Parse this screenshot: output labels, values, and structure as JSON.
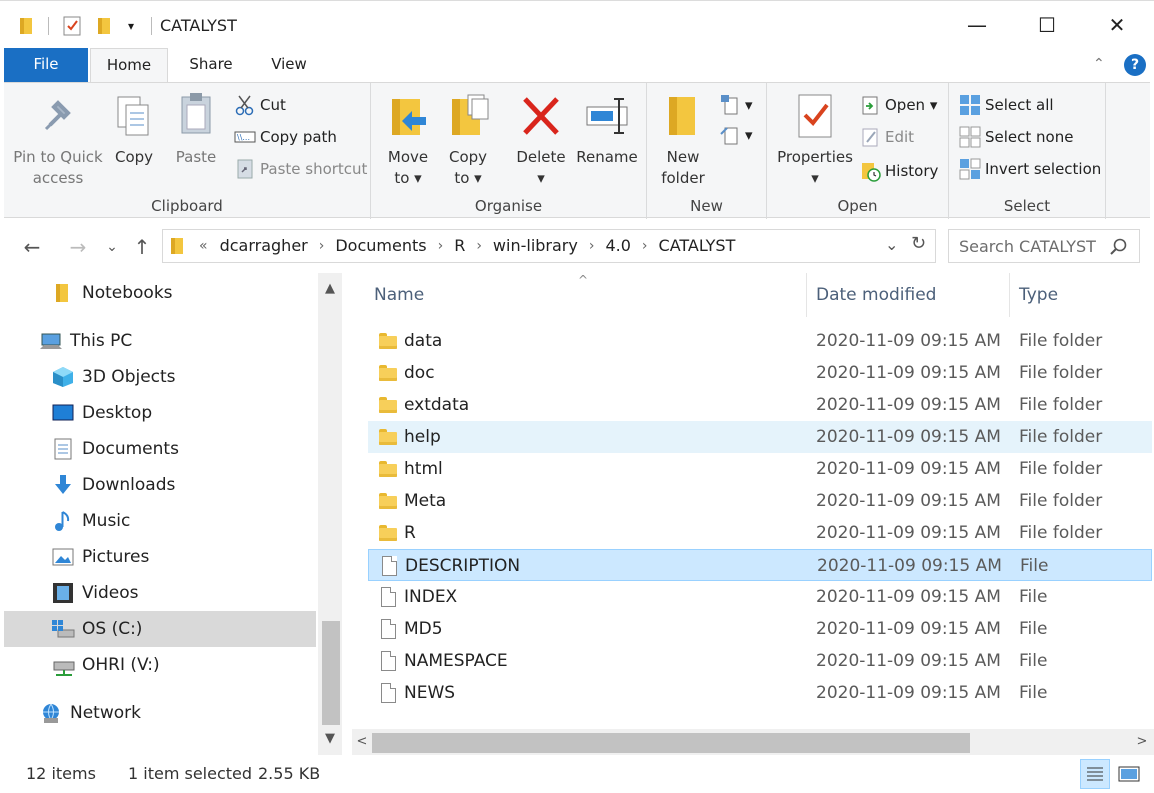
{
  "window": {
    "title": "CATALYST",
    "minimize": "—",
    "maximize": "☐",
    "close": "✕",
    "qa_dropdown": "▾"
  },
  "tabs": {
    "file": "File",
    "home": "Home",
    "share": "Share",
    "view": "View",
    "collapse": "⌃",
    "help": "?"
  },
  "ribbon": {
    "clipboard": {
      "label": "Clipboard",
      "pin_line1": "Pin to Quick",
      "pin_line2": "access",
      "copy": "Copy",
      "paste": "Paste",
      "cut": "Cut",
      "copy_path": "Copy path",
      "paste_shortcut": "Paste shortcut"
    },
    "organise": {
      "label": "Organise",
      "move_line1": "Move",
      "move_line2": "to",
      "copy_line1": "Copy",
      "copy_line2": "to",
      "delete": "Delete",
      "rename": "Rename",
      "dropdown": "▾"
    },
    "new": {
      "label": "New",
      "new_folder_line1": "New",
      "new_folder_line2": "folder"
    },
    "open": {
      "label": "Open",
      "properties": "Properties",
      "open": "Open",
      "edit": "Edit",
      "history": "History"
    },
    "select": {
      "label": "Select",
      "select_all": "Select all",
      "select_none": "Select none",
      "invert_selection": "Invert selection"
    }
  },
  "nav": {
    "back": "←",
    "forward": "→",
    "recent": "⌄",
    "up": "↑",
    "overflow": "«",
    "crumbs": [
      "dcarragher",
      "Documents",
      "R",
      "win-library",
      "4.0",
      "CATALYST"
    ],
    "chevron": "›",
    "dropdown": "⌄",
    "refresh": "↻",
    "search_placeholder": "Search CATALYST"
  },
  "navpane": {
    "items": [
      "Notebooks",
      "This PC",
      "3D Objects",
      "Desktop",
      "Documents",
      "Downloads",
      "Music",
      "Pictures",
      "Videos",
      "OS (C:)",
      "OHRI (V:)",
      "Network"
    ],
    "scroll_up": "▲",
    "scroll_down": "▼"
  },
  "filelist": {
    "columns": {
      "name": "Name",
      "date": "Date modified",
      "type": "Type"
    },
    "sort_indicator": "^",
    "rows": [
      {
        "name": "data",
        "date": "2020-11-09 09:15 AM",
        "type": "File folder"
      },
      {
        "name": "doc",
        "date": "2020-11-09 09:15 AM",
        "type": "File folder"
      },
      {
        "name": "extdata",
        "date": "2020-11-09 09:15 AM",
        "type": "File folder"
      },
      {
        "name": "help",
        "date": "2020-11-09 09:15 AM",
        "type": "File folder"
      },
      {
        "name": "html",
        "date": "2020-11-09 09:15 AM",
        "type": "File folder"
      },
      {
        "name": "Meta",
        "date": "2020-11-09 09:15 AM",
        "type": "File folder"
      },
      {
        "name": "R",
        "date": "2020-11-09 09:15 AM",
        "type": "File folder"
      },
      {
        "name": "DESCRIPTION",
        "date": "2020-11-09 09:15 AM",
        "type": "File"
      },
      {
        "name": "INDEX",
        "date": "2020-11-09 09:15 AM",
        "type": "File"
      },
      {
        "name": "MD5",
        "date": "2020-11-09 09:15 AM",
        "type": "File"
      },
      {
        "name": "NAMESPACE",
        "date": "2020-11-09 09:15 AM",
        "type": "File"
      },
      {
        "name": "NEWS",
        "date": "2020-11-09 09:15 AM",
        "type": "File"
      }
    ],
    "scroll_left": "<",
    "scroll_right": ">"
  },
  "status": {
    "count": "12 items",
    "selected": "1 item selected",
    "size": "2.55 KB"
  },
  "colors": {
    "accent": "#1a6fc4",
    "selected_bg": "#cce8ff",
    "hover_bg": "#e5f3fb"
  }
}
